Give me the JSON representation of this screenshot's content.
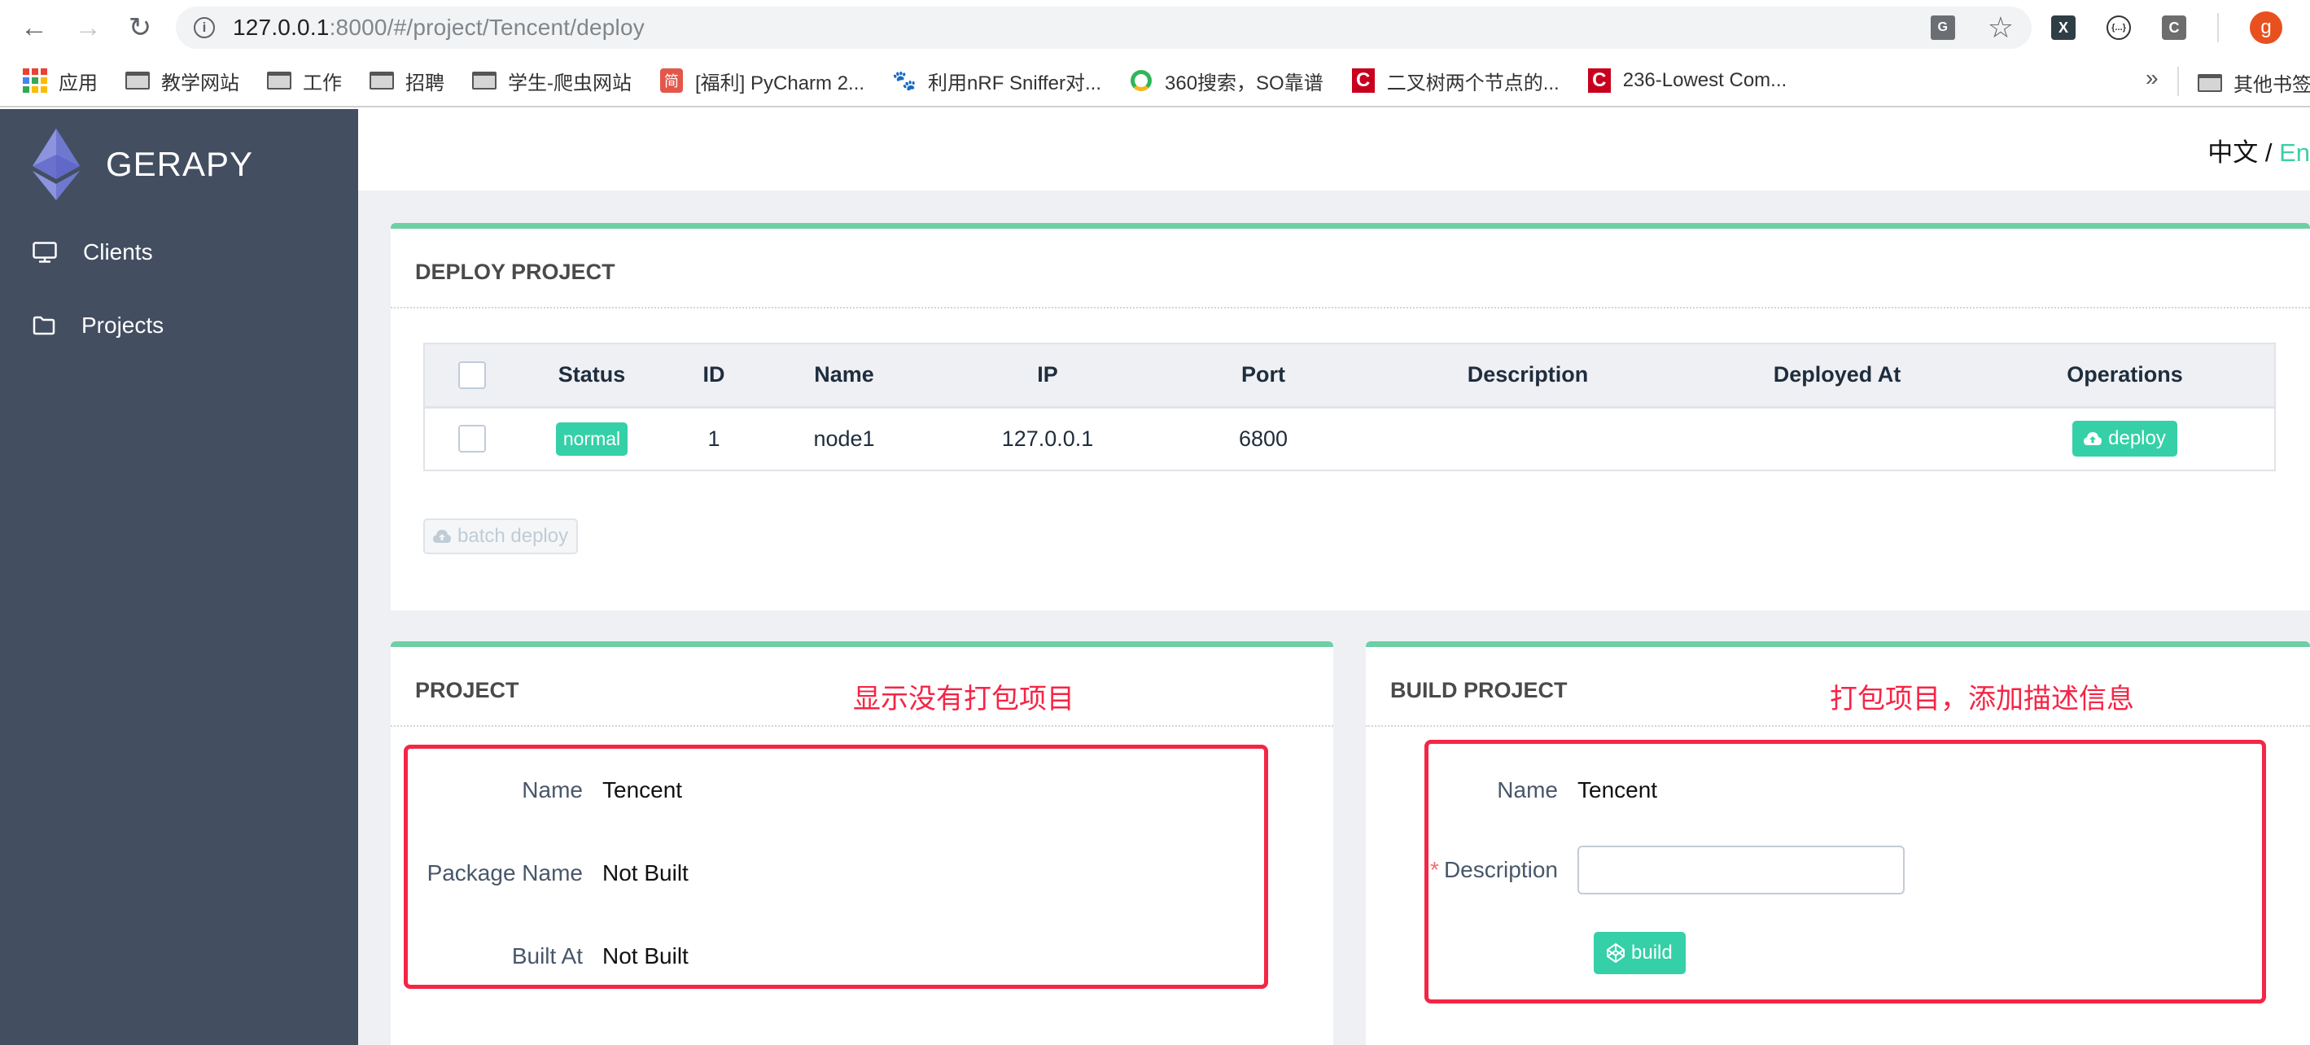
{
  "browser": {
    "url_host": "127.0.0.1",
    "url_rest": ":8000/#/project/Tencent/deploy",
    "avatar_letter": "g",
    "extensions": [
      "X",
      "{...}",
      "C"
    ],
    "bookmarks": [
      {
        "label": "应用",
        "icon": "apps-grid-icon"
      },
      {
        "label": "教学网站",
        "icon": "folder-icon"
      },
      {
        "label": "工作",
        "icon": "folder-icon"
      },
      {
        "label": "招聘",
        "icon": "folder-icon"
      },
      {
        "label": "学生-爬虫网站",
        "icon": "folder-icon"
      },
      {
        "label": "[福利] PyCharm 2...",
        "icon": "jian-icon"
      },
      {
        "label": "利用nRF Sniffer对...",
        "icon": "baidu-paw-icon"
      },
      {
        "label": "360搜索，SO靠谱",
        "icon": "360-search-icon"
      },
      {
        "label": "二叉树两个节点的...",
        "icon": "csdn-icon"
      },
      {
        "label": "236-Lowest Com...",
        "icon": "csdn-icon"
      }
    ],
    "more_label": "»",
    "other_bookmarks": "其他书签"
  },
  "sidebar": {
    "logo_text": "GERAPY",
    "items": [
      {
        "label": "Clients",
        "icon": "monitor-icon"
      },
      {
        "label": "Projects",
        "icon": "folder-icon"
      }
    ]
  },
  "header": {
    "lang_zh": "中文",
    "lang_sep": " / ",
    "lang_en": "En"
  },
  "deploy": {
    "title": "DEPLOY PROJECT",
    "columns": [
      "",
      "Status",
      "ID",
      "Name",
      "IP",
      "Port",
      "Description",
      "Deployed At",
      "Operations"
    ],
    "rows": [
      {
        "status": "normal",
        "id": "1",
        "name": "node1",
        "ip": "127.0.0.1",
        "port": "6800",
        "description": "",
        "deployed_at": "",
        "action": "deploy"
      }
    ],
    "batch_label": "batch deploy"
  },
  "project": {
    "title": "PROJECT",
    "annotation": "显示没有打包项目",
    "fields": [
      {
        "label": "Name",
        "value": "Tencent"
      },
      {
        "label": "Package Name",
        "value": "Not Built"
      },
      {
        "label": "Built At",
        "value": "Not Built"
      }
    ]
  },
  "build": {
    "title": "BUILD PROJECT",
    "annotation": "打包项目，添加描述信息",
    "name_label": "Name",
    "name_value": "Tencent",
    "required_mark": "*",
    "description_label": "Description",
    "description_value": "",
    "description_placeholder": "",
    "build_label": "build"
  },
  "colors": {
    "accent": "#35d0a7",
    "sidebar": "#434e61",
    "annotation": "#f52546"
  }
}
